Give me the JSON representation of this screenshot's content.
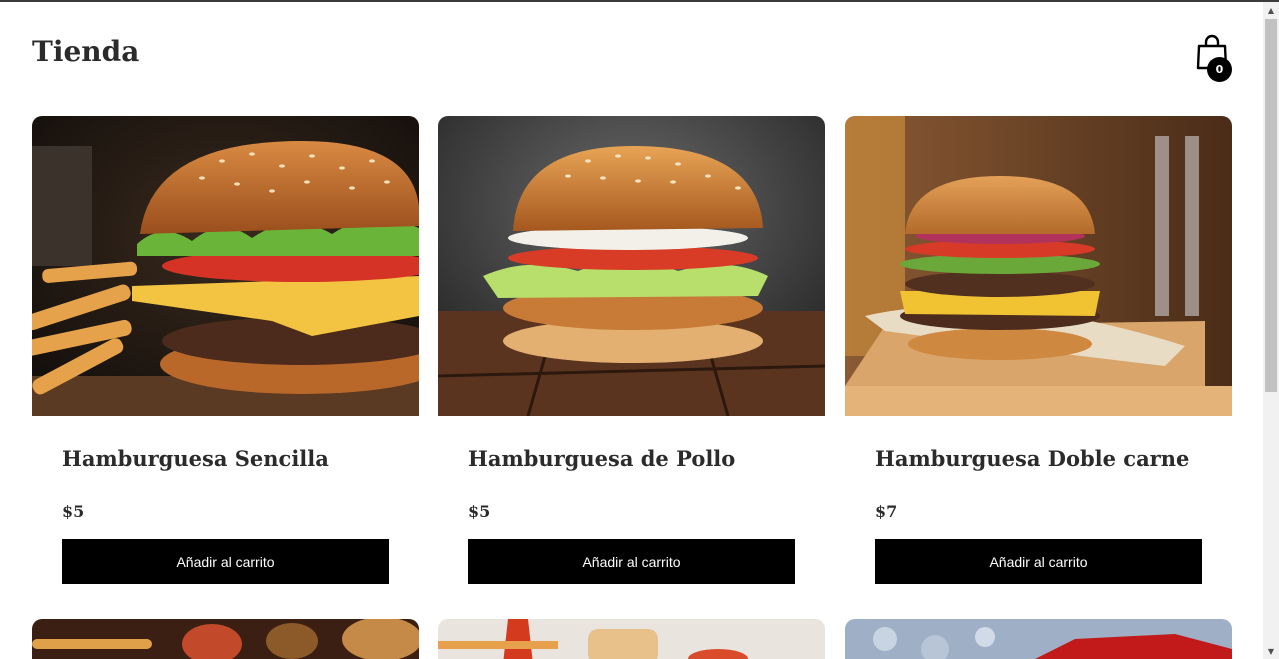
{
  "header": {
    "title": "Tienda",
    "cart_icon": "shopping-bag-icon",
    "cart_count": "0"
  },
  "products": [
    {
      "name": "Hamburguesa Sencilla",
      "price": "$5",
      "button_label": "Añadir al carrito",
      "image": "cheeseburger-with-fries-photo"
    },
    {
      "name": "Hamburguesa de Pollo",
      "price": "$5",
      "button_label": "Añadir al carrito",
      "image": "chicken-burger-photo"
    },
    {
      "name": "Hamburguesa Doble carne",
      "price": "$7",
      "button_label": "Añadir al carrito",
      "image": "double-beef-burger-photo"
    }
  ],
  "products_row2": [
    {
      "image": "assorted-food-photo"
    },
    {
      "image": "hot-dog-photo"
    },
    {
      "image": "drink-on-ice-photo"
    }
  ],
  "colors": {
    "accent": "#000000",
    "text": "#2b2b2b",
    "background": "#ffffff"
  }
}
